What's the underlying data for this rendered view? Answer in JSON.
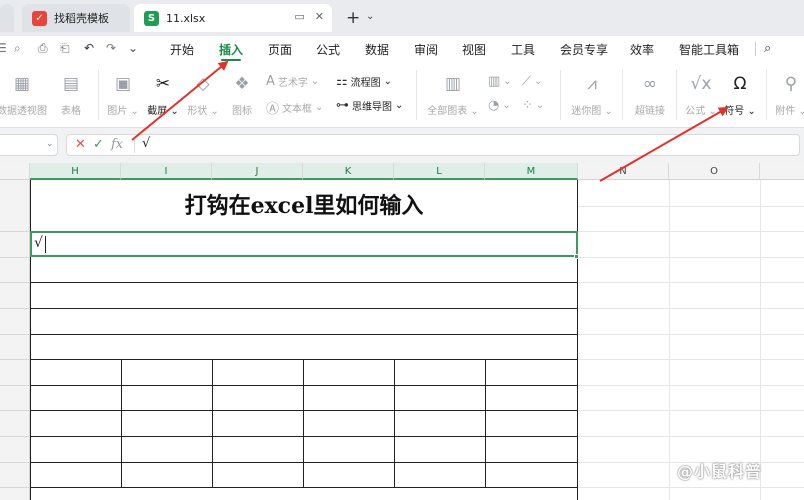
{
  "tabs": [
    {
      "label": "找稻壳模板",
      "icon": "docer-icon",
      "icon_color": "#e8443a"
    },
    {
      "label": "11.xlsx",
      "icon": "spreadsheet-icon",
      "icon_color": "#1f9d55",
      "active": true
    }
  ],
  "quick_access": [
    "undo",
    "redo"
  ],
  "menu": {
    "items": [
      "开始",
      "插入",
      "页面",
      "公式",
      "数据",
      "审阅",
      "视图",
      "工具",
      "会员专享",
      "效率",
      "智能工具箱"
    ],
    "active": "插入",
    "accent": "#188a4a"
  },
  "ribbon": {
    "pivot_view": "数据透视图",
    "table": "表格",
    "picture": "图片",
    "screenshot": "截屏",
    "shape": "形状",
    "icons": "图标",
    "art_text": "艺术字",
    "textbox": "文本框",
    "flowchart": "流程图",
    "mindmap": "思维导图",
    "all_charts": "全部图表",
    "sparkline": "迷你图",
    "hyperlink": "超链接",
    "formula": "公式",
    "symbol": "符号",
    "attachment": "附件"
  },
  "formula_bar": {
    "fx": "fx",
    "value": "√"
  },
  "columns": [
    "H",
    "I",
    "J",
    "K",
    "L",
    "M",
    "N",
    "O"
  ],
  "sheet": {
    "title": "打钩在excel里如何输入",
    "active_cell_value": "√",
    "grid_color": "#3f9a5f"
  },
  "watermark": "@小鼠科普",
  "annotation_color": "#e0322b"
}
